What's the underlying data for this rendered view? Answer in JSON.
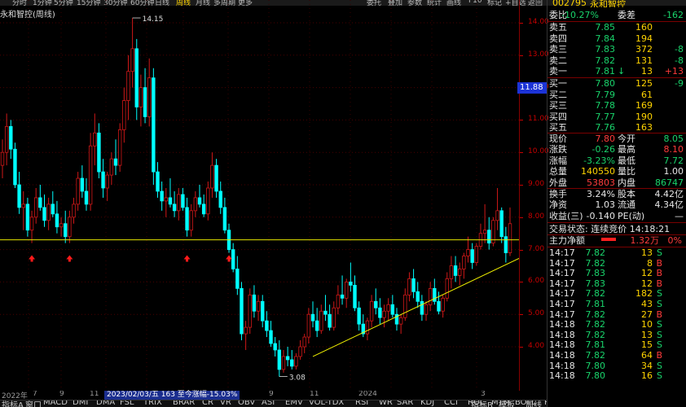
{
  "toolbar": {
    "items": [
      "分时",
      "1分钟",
      "5分钟",
      "15分钟",
      "30分钟",
      "60分钟",
      "日线",
      "周线",
      "月线",
      "多周期",
      "更多"
    ],
    "active": "周线",
    "right_items": [
      "委托",
      "叠加",
      "参数",
      "统计",
      "画线",
      "F10",
      "标记",
      "+自选",
      "返回"
    ]
  },
  "stock": {
    "code": "002795",
    "name": "永和智控",
    "chart_title": "永和智控(周线)"
  },
  "chart_data": {
    "type": "candlestick",
    "period": "weekly",
    "ylim": [
      3.0,
      14.3
    ],
    "yticks": [
      4.0,
      5.0,
      6.0,
      7.0,
      8.0,
      9.0,
      10.0,
      11.0,
      12.0,
      13.0,
      14.0
    ],
    "current_price": "11.88",
    "annotations": {
      "high": "14.15",
      "low": "3.08"
    },
    "x_labels": [
      "2022年",
      "7",
      "9",
      "11",
      "2023",
      "3",
      "5",
      "7",
      "9",
      "11",
      "2024",
      "3"
    ],
    "support_line_value": 7.3,
    "trend_line": {
      "from": {
        "index": 74,
        "value": 3.7
      },
      "to": {
        "index": 124,
        "value": 6.9
      }
    },
    "up_arrow_indices": [
      7,
      16,
      44,
      54,
      124
    ],
    "candles": [
      [
        9.6,
        10.4,
        9.2,
        10.0
      ],
      [
        10.0,
        11.2,
        9.6,
        10.8
      ],
      [
        10.8,
        11.0,
        9.8,
        10.1
      ],
      [
        10.1,
        10.3,
        8.9,
        9.0
      ],
      [
        9.0,
        9.4,
        8.1,
        8.3
      ],
      [
        8.3,
        8.8,
        7.6,
        8.4
      ],
      [
        8.4,
        8.6,
        7.4,
        7.6
      ],
      [
        7.6,
        8.2,
        7.2,
        8.0
      ],
      [
        8.0,
        8.9,
        7.8,
        8.6
      ],
      [
        8.6,
        9.0,
        8.2,
        8.3
      ],
      [
        8.3,
        8.7,
        7.7,
        7.9
      ],
      [
        7.9,
        8.6,
        7.6,
        8.4
      ],
      [
        8.4,
        8.8,
        8.0,
        8.1
      ],
      [
        8.1,
        8.5,
        7.5,
        7.7
      ],
      [
        7.7,
        8.0,
        7.4,
        7.8
      ],
      [
        7.8,
        8.2,
        7.2,
        7.4
      ],
      [
        7.4,
        8.2,
        7.2,
        8.0
      ],
      [
        8.0,
        8.6,
        7.8,
        8.4
      ],
      [
        8.4,
        9.4,
        8.2,
        9.2
      ],
      [
        9.2,
        9.6,
        8.6,
        8.8
      ],
      [
        8.8,
        9.2,
        8.2,
        8.4
      ],
      [
        8.4,
        10.6,
        8.2,
        10.2
      ],
      [
        10.2,
        11.2,
        9.6,
        10.6
      ],
      [
        10.6,
        10.9,
        9.2,
        9.4
      ],
      [
        9.4,
        9.8,
        8.6,
        8.9
      ],
      [
        8.9,
        9.4,
        8.5,
        9.3
      ],
      [
        9.3,
        10.0,
        9.0,
        9.8
      ],
      [
        9.8,
        10.4,
        9.3,
        9.6
      ],
      [
        9.6,
        10.9,
        9.4,
        10.7
      ],
      [
        10.7,
        12.0,
        10.3,
        11.6
      ],
      [
        11.6,
        13.0,
        11.0,
        12.5
      ],
      [
        12.5,
        14.15,
        12.0,
        13.2
      ],
      [
        13.2,
        13.5,
        11.0,
        11.4
      ],
      [
        11.4,
        12.4,
        10.8,
        12.0
      ],
      [
        12.0,
        12.6,
        10.9,
        11.1
      ],
      [
        11.1,
        12.9,
        10.8,
        12.3
      ],
      [
        12.3,
        12.6,
        9.0,
        9.4
      ],
      [
        9.4,
        9.7,
        8.6,
        8.8
      ],
      [
        8.8,
        9.1,
        8.2,
        8.5
      ],
      [
        8.5,
        8.9,
        8.0,
        8.6
      ],
      [
        8.6,
        9.2,
        8.3,
        8.4
      ],
      [
        8.4,
        8.8,
        8.0,
        8.2
      ],
      [
        8.2,
        8.9,
        7.9,
        8.7
      ],
      [
        8.7,
        8.9,
        8.2,
        8.3
      ],
      [
        8.3,
        8.6,
        7.4,
        7.6
      ],
      [
        7.6,
        8.4,
        7.4,
        8.2
      ],
      [
        8.2,
        8.8,
        8.0,
        8.6
      ],
      [
        8.6,
        9.0,
        8.3,
        8.4
      ],
      [
        8.4,
        8.7,
        8.0,
        8.1
      ],
      [
        8.1,
        9.1,
        7.9,
        8.9
      ],
      [
        8.9,
        10.0,
        8.6,
        9.6
      ],
      [
        9.6,
        9.8,
        8.6,
        8.8
      ],
      [
        8.8,
        9.1,
        8.1,
        8.3
      ],
      [
        8.3,
        8.6,
        7.5,
        7.6
      ],
      [
        7.6,
        7.8,
        6.9,
        7.0
      ],
      [
        7.0,
        7.2,
        6.3,
        6.4
      ],
      [
        6.4,
        6.8,
        5.6,
        5.8
      ],
      [
        5.8,
        6.0,
        4.2,
        4.4
      ],
      [
        4.4,
        4.8,
        3.9,
        4.6
      ],
      [
        4.6,
        5.8,
        4.4,
        5.6
      ],
      [
        5.6,
        5.9,
        4.9,
        5.1
      ],
      [
        5.1,
        5.6,
        4.8,
        5.4
      ],
      [
        5.4,
        5.6,
        4.6,
        4.8
      ],
      [
        4.8,
        5.1,
        4.3,
        4.5
      ],
      [
        4.5,
        4.8,
        4.0,
        4.1
      ],
      [
        4.1,
        4.3,
        3.7,
        3.9
      ],
      [
        3.9,
        4.2,
        3.08,
        3.3
      ],
      [
        3.3,
        3.9,
        3.2,
        3.7
      ],
      [
        3.7,
        4.0,
        3.4,
        3.6
      ],
      [
        3.6,
        3.9,
        3.3,
        3.4
      ],
      [
        3.4,
        3.8,
        3.3,
        3.7
      ],
      [
        3.7,
        4.2,
        3.6,
        4.0
      ],
      [
        4.0,
        4.4,
        3.8,
        4.3
      ],
      [
        4.3,
        5.2,
        4.1,
        5.0
      ],
      [
        5.0,
        5.4,
        4.6,
        4.8
      ],
      [
        4.8,
        5.2,
        4.3,
        4.5
      ],
      [
        4.5,
        5.3,
        4.4,
        5.1
      ],
      [
        5.1,
        5.6,
        4.8,
        5.0
      ],
      [
        5.0,
        5.3,
        4.5,
        4.6
      ],
      [
        4.6,
        5.4,
        4.5,
        5.2
      ],
      [
        5.2,
        5.9,
        5.0,
        5.6
      ],
      [
        5.6,
        6.2,
        5.3,
        5.5
      ],
      [
        5.5,
        6.1,
        5.2,
        6.0
      ],
      [
        6.0,
        6.6,
        5.7,
        5.9
      ],
      [
        5.9,
        6.2,
        5.1,
        5.2
      ],
      [
        5.2,
        5.4,
        4.5,
        4.7
      ],
      [
        4.7,
        5.0,
        4.3,
        4.4
      ],
      [
        4.4,
        4.9,
        4.2,
        4.8
      ],
      [
        4.8,
        5.6,
        4.6,
        5.4
      ],
      [
        5.4,
        5.8,
        5.0,
        5.2
      ],
      [
        5.2,
        5.5,
        4.7,
        4.9
      ],
      [
        4.9,
        5.3,
        4.6,
        5.1
      ],
      [
        5.1,
        5.5,
        4.8,
        5.3
      ],
      [
        5.3,
        5.6,
        4.9,
        5.0
      ],
      [
        5.0,
        5.2,
        4.5,
        4.7
      ],
      [
        4.7,
        5.0,
        4.4,
        4.9
      ],
      [
        4.9,
        5.8,
        4.8,
        5.6
      ],
      [
        5.6,
        6.3,
        5.4,
        6.1
      ],
      [
        6.1,
        6.4,
        5.5,
        5.7
      ],
      [
        5.7,
        6.0,
        5.2,
        5.4
      ],
      [
        5.4,
        5.6,
        4.8,
        5.0
      ],
      [
        5.0,
        5.4,
        4.8,
        5.3
      ],
      [
        5.3,
        6.0,
        5.1,
        5.8
      ],
      [
        5.8,
        6.1,
        5.3,
        5.4
      ],
      [
        5.4,
        5.7,
        5.0,
        5.1
      ],
      [
        5.1,
        5.6,
        4.9,
        5.5
      ],
      [
        5.5,
        6.3,
        5.4,
        6.1
      ],
      [
        6.1,
        6.8,
        5.8,
        6.5
      ],
      [
        6.5,
        6.8,
        6.0,
        6.2
      ],
      [
        6.2,
        6.6,
        5.9,
        6.4
      ],
      [
        6.4,
        6.9,
        6.1,
        6.8
      ],
      [
        6.8,
        7.4,
        6.6,
        7.0
      ],
      [
        7.0,
        7.2,
        6.4,
        6.6
      ],
      [
        6.6,
        7.2,
        6.5,
        7.1
      ],
      [
        7.1,
        7.8,
        7.0,
        7.5
      ],
      [
        7.5,
        8.4,
        7.2,
        7.6
      ],
      [
        7.6,
        8.0,
        7.0,
        7.2
      ],
      [
        7.2,
        8.0,
        7.1,
        7.9
      ],
      [
        7.9,
        8.9,
        7.6,
        8.2
      ],
      [
        8.2,
        8.3,
        7.2,
        7.4
      ],
      [
        7.4,
        7.7,
        6.6,
        6.9
      ],
      [
        6.9,
        8.3,
        6.8,
        7.8
      ]
    ]
  },
  "indicators": {
    "tabs": [
      "指标A",
      "窗口",
      "MACD",
      "DMI",
      "DMA",
      "FSL",
      "TRIX",
      "BRAR",
      "CR",
      "VR",
      "OBV",
      "ASI",
      "EMV",
      "VOL-TDX",
      "RSI",
      "WR",
      "SAR",
      "KDJ",
      "CCI",
      "ROC",
      "MTM",
      "BOLL",
      "PSY"
    ],
    "right_tabs": [
      "指标B",
      "模板"
    ],
    "cursor_info": "2023/02/03/五 163 至今涨幅-15.03%",
    "week_label": "周线"
  },
  "quote": {
    "header": {
      "label": "委比",
      "value": "-10.27%",
      "label2": "委差",
      "value2": "-162"
    },
    "asks": [
      {
        "label": "卖五",
        "price": "7.85",
        "vol": "160",
        "chg": ""
      },
      {
        "label": "卖四",
        "price": "7.84",
        "vol": "194",
        "chg": ""
      },
      {
        "label": "卖三",
        "price": "7.83",
        "vol": "372",
        "chg": "-8"
      },
      {
        "label": "卖二",
        "price": "7.82",
        "vol": "131",
        "chg": "-8"
      },
      {
        "label": "卖一",
        "price": "7.81",
        "vol": "13",
        "chg": "+13",
        "arrow": "↓"
      }
    ],
    "bids": [
      {
        "label": "买一",
        "price": "7.80",
        "vol": "125",
        "chg": "-9"
      },
      {
        "label": "买二",
        "price": "7.79",
        "vol": "61",
        "chg": ""
      },
      {
        "label": "买三",
        "price": "7.78",
        "vol": "169",
        "chg": ""
      },
      {
        "label": "买四",
        "price": "7.77",
        "vol": "190",
        "chg": ""
      },
      {
        "label": "买五",
        "price": "7.76",
        "vol": "163",
        "chg": ""
      }
    ],
    "stats": [
      {
        "l1": "现价",
        "v1": "7.80",
        "l2": "今开",
        "v2": "8.05",
        "c1": "red",
        "c2": "green"
      },
      {
        "l1": "涨跌",
        "v1": "-0.26",
        "l2": "最高",
        "v2": "8.10",
        "c1": "green",
        "c2": "red"
      },
      {
        "l1": "涨幅",
        "v1": "-3.23%",
        "l2": "最低",
        "v2": "7.72",
        "c1": "green",
        "c2": "green"
      },
      {
        "l1": "总量",
        "v1": "140550",
        "l2": "量比",
        "v2": "1.00",
        "c1": "yellow",
        "c2": "white"
      },
      {
        "l1": "外盘",
        "v1": "53803",
        "l2": "内盘",
        "v2": "86747",
        "c1": "red",
        "c2": "green"
      }
    ],
    "stats2": [
      {
        "l1": "换手",
        "v1": "3.24%",
        "l2": "股本",
        "v2": "4.42亿"
      },
      {
        "l1": "净资",
        "v1": "1.03",
        "l2": "流通",
        "v2": "4.34亿"
      },
      {
        "l1": "收益(三)",
        "v1": "-0.140",
        "l2": "PE(动)",
        "v2": "—"
      }
    ],
    "trade_status": "交易状态: 连续竞价 14:18:21",
    "main_flow": {
      "label": "主力净额",
      "value": "1.32万",
      "pct": "0%"
    },
    "ticks": [
      {
        "time": "14:17",
        "price": "7.82",
        "vol": "13",
        "side": "S"
      },
      {
        "time": "14:17",
        "price": "7.82",
        "vol": "8",
        "side": "B"
      },
      {
        "time": "14:17",
        "price": "7.83",
        "vol": "12",
        "side": "B"
      },
      {
        "time": "14:17",
        "price": "7.83",
        "vol": "12",
        "side": "B"
      },
      {
        "time": "14:17",
        "price": "7.82",
        "vol": "182",
        "side": "S"
      },
      {
        "time": "14:17",
        "price": "7.81",
        "vol": "43",
        "side": "S"
      },
      {
        "time": "14:17",
        "price": "7.82",
        "vol": "27",
        "side": "B"
      },
      {
        "time": "14:18",
        "price": "7.82",
        "vol": "10",
        "side": "S"
      },
      {
        "time": "14:18",
        "price": "7.82",
        "vol": "13",
        "side": "S"
      },
      {
        "time": "14:18",
        "price": "7.81",
        "vol": "15",
        "side": "S"
      },
      {
        "time": "14:18",
        "price": "7.82",
        "vol": "64",
        "side": "B"
      },
      {
        "time": "14:18",
        "price": "7.80",
        "vol": "34",
        "side": "S"
      },
      {
        "time": "14:18",
        "price": "7.80",
        "vol": "16",
        "side": "S"
      }
    ]
  },
  "colors": {
    "up": "#ff3b3b",
    "down": "#00ffff",
    "support": "#e6e600",
    "trend": "#f0f000",
    "axis": "#c80000",
    "price_tag": "#1c33d6"
  }
}
